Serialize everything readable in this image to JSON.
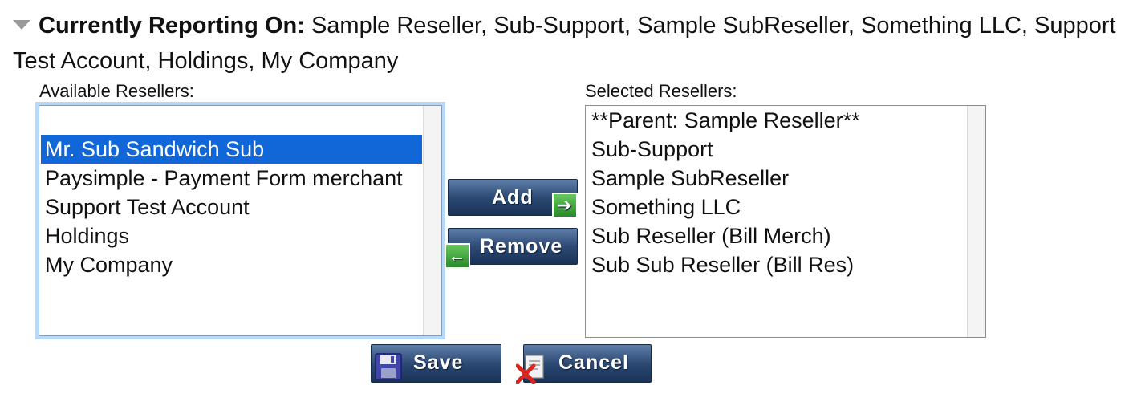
{
  "header": {
    "label": "Currently Reporting On:",
    "value": " Sample Reseller, Sub-Support, Sample SubReseller, Something LLC, Support Test Account, Holdings, My Company"
  },
  "available": {
    "label": "Available Resellers:",
    "items": [
      {
        "text": "",
        "selected": false
      },
      {
        "text": "Mr. Sub Sandwich Sub",
        "selected": true
      },
      {
        "text": "Paysimple - Payment Form merchant",
        "selected": false
      },
      {
        "text": "Support Test Account",
        "selected": false
      },
      {
        "text": "Holdings",
        "selected": false
      },
      {
        "text": "My Company",
        "selected": false
      }
    ]
  },
  "selected": {
    "label": "Selected Resellers:",
    "items": [
      {
        "text": "**Parent: Sample Reseller**",
        "selected": false
      },
      {
        "text": "Sub-Support",
        "selected": false
      },
      {
        "text": "Sample SubReseller",
        "selected": false
      },
      {
        "text": "Something LLC",
        "selected": false
      },
      {
        "text": "Sub Reseller (Bill Merch)",
        "selected": false
      },
      {
        "text": "Sub Sub Reseller (Bill Res)",
        "selected": false
      }
    ]
  },
  "buttons": {
    "add": "Add",
    "remove": "Remove",
    "save": "Save",
    "cancel": "Cancel"
  },
  "icons": {
    "add": "arrow-right-icon",
    "remove": "arrow-left-icon",
    "save": "floppy-disk-icon",
    "cancel": "cancel-document-icon",
    "toggle": "triangle-down-icon"
  },
  "colors": {
    "selection": "#1267d8",
    "button": "#2c4a74",
    "focus_ring": "#b9d7f7",
    "icon_green": "#3ca83a"
  }
}
